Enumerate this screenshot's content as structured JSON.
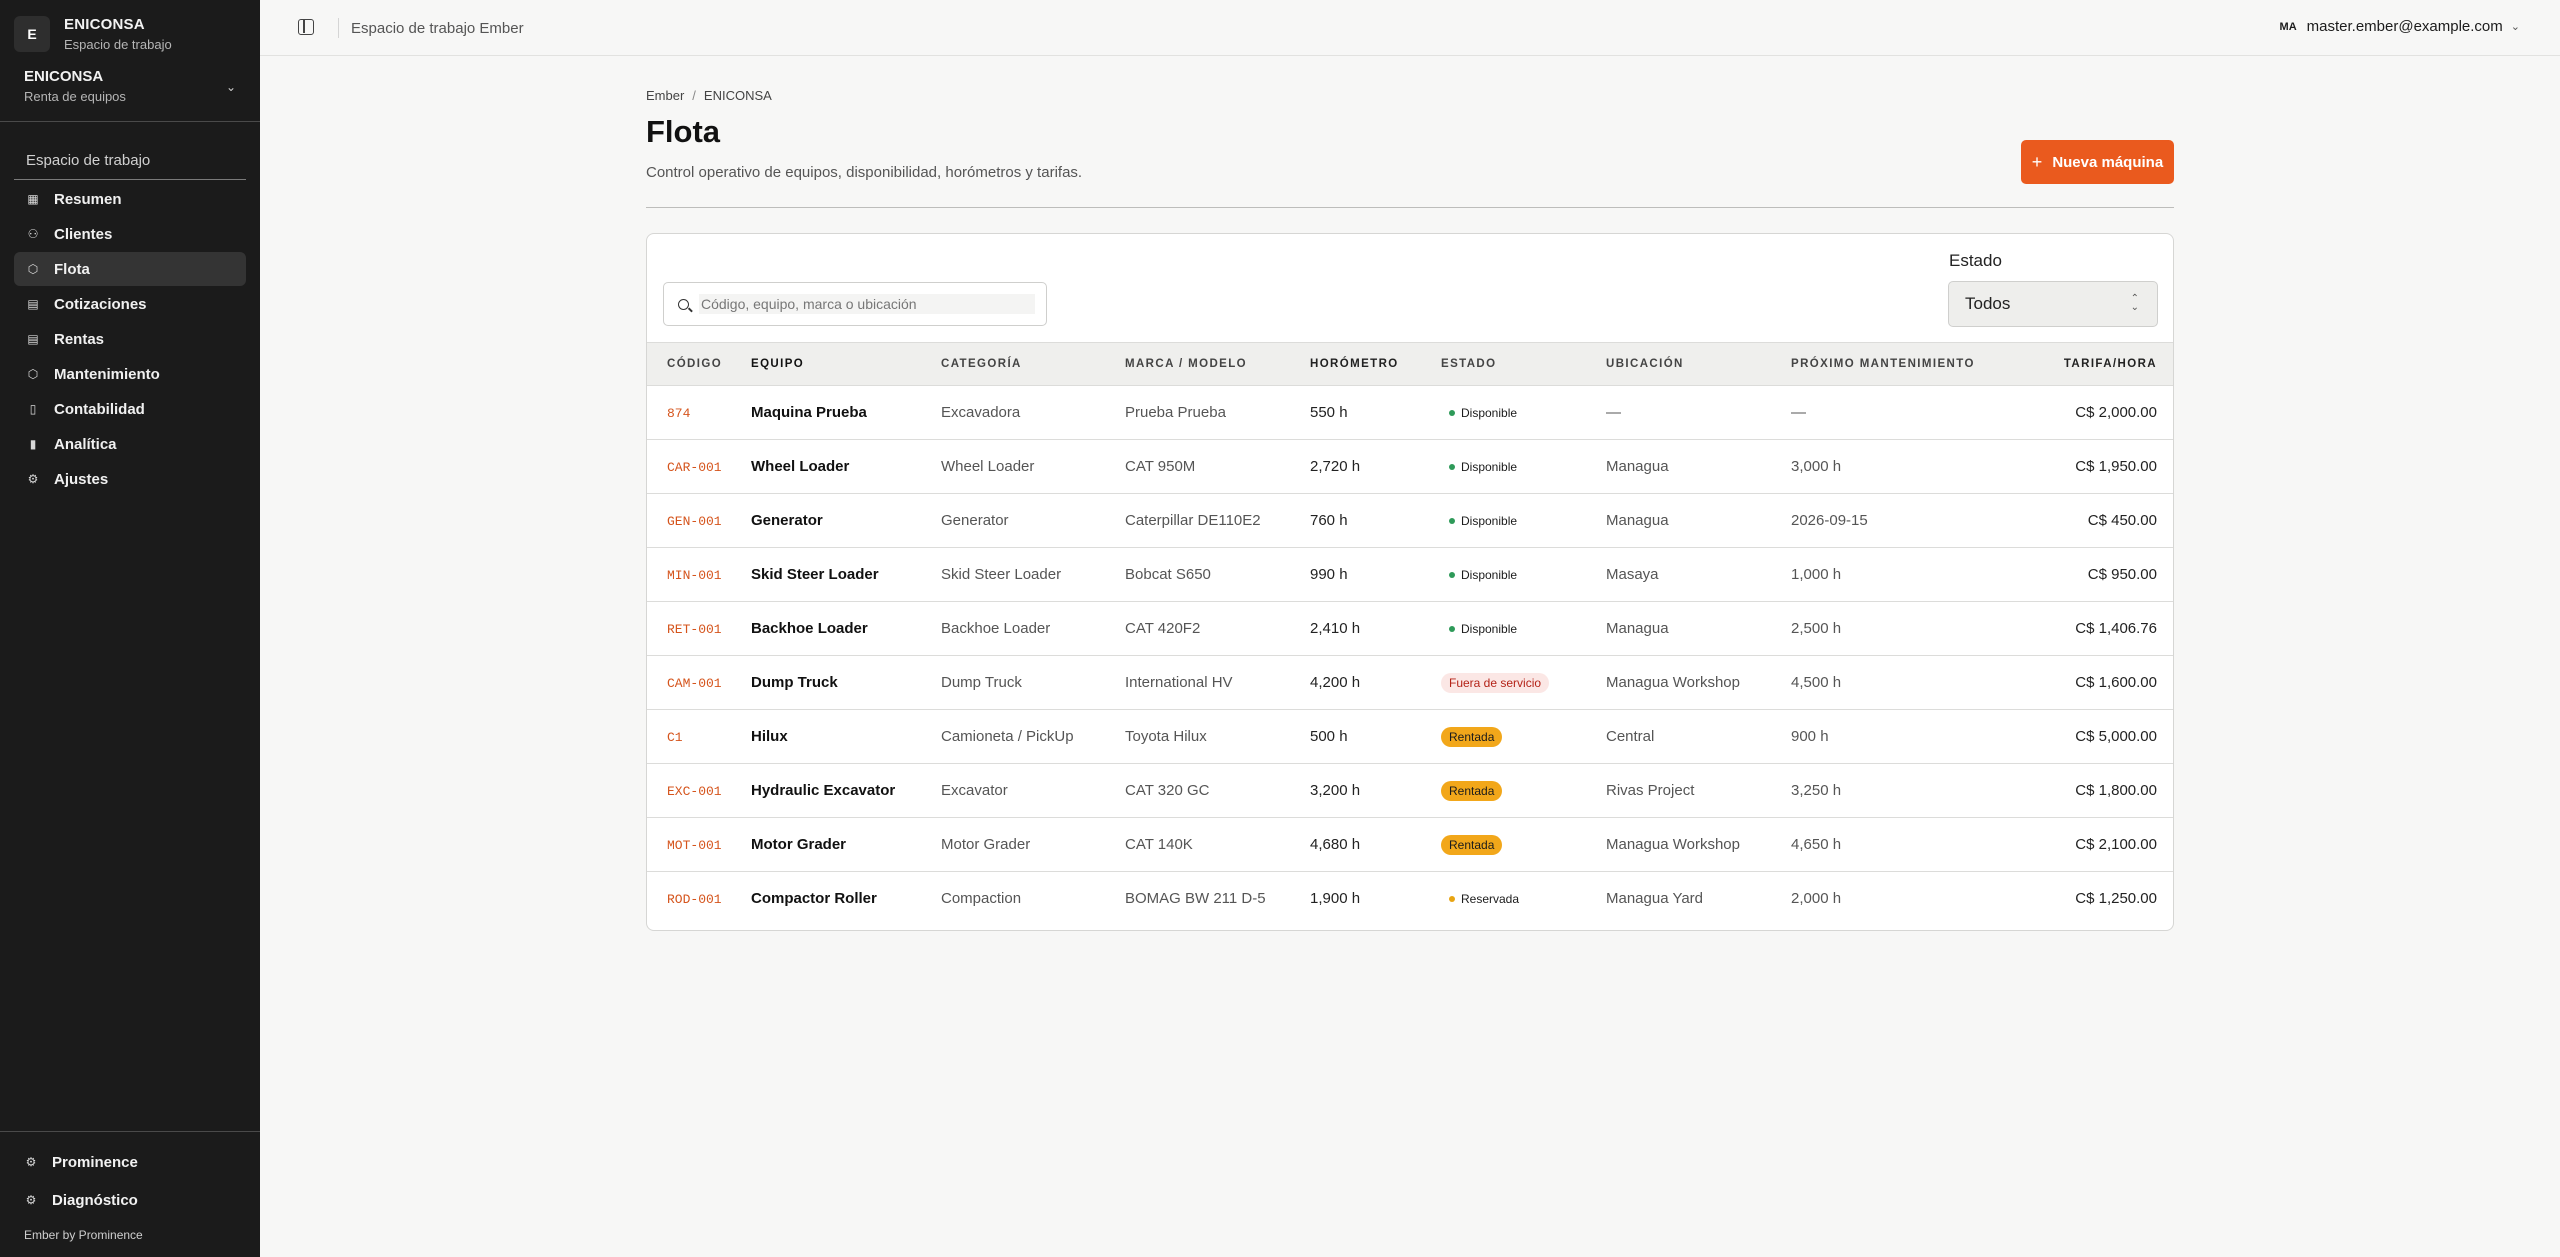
{
  "brand": {
    "initial": "E",
    "name": "ENICONSA",
    "subtitle": "Espacio de trabajo"
  },
  "org": {
    "name": "ENICONSA",
    "subtitle": "Renta de equipos"
  },
  "sidebar": {
    "section_label": "Espacio de trabajo",
    "items": [
      {
        "label": "Resumen",
        "icon": "grid-icon",
        "glyph": "▦"
      },
      {
        "label": "Clientes",
        "icon": "users-icon",
        "glyph": "⚇"
      },
      {
        "label": "Flota",
        "icon": "box-icon",
        "glyph": "⬡",
        "active": true
      },
      {
        "label": "Cotizaciones",
        "icon": "file-icon",
        "glyph": "▤"
      },
      {
        "label": "Rentas",
        "icon": "file-icon",
        "glyph": "▤"
      },
      {
        "label": "Mantenimiento",
        "icon": "box-icon",
        "glyph": "⬡"
      },
      {
        "label": "Contabilidad",
        "icon": "document-icon",
        "glyph": "▯"
      },
      {
        "label": "Analítica",
        "icon": "bar-chart-icon",
        "glyph": "▮"
      },
      {
        "label": "Ajustes",
        "icon": "gear-icon",
        "glyph": "⚙"
      }
    ],
    "footer": [
      {
        "label": "Prominence",
        "icon": "gear-icon",
        "glyph": "⚙"
      },
      {
        "label": "Diagnóstico",
        "icon": "gear-icon",
        "glyph": "⚙"
      }
    ],
    "credit": "Ember by Prominence"
  },
  "topbar": {
    "title": "Espacio de trabajo Ember",
    "user_initials": "MA",
    "user_email": "master.ember@example.com"
  },
  "breadcrumb": [
    "Ember",
    "ENICONSA"
  ],
  "page": {
    "title": "Flota",
    "description": "Control operativo de equipos, disponibilidad, horómetros y tarifas.",
    "new_button": "Nueva máquina"
  },
  "search": {
    "placeholder": "Código, equipo, marca o ubicación",
    "value": ""
  },
  "filter": {
    "label": "Estado",
    "value": "Todos"
  },
  "table": {
    "columns": [
      "CÓDIGO",
      "EQUIPO",
      "CATEGORÍA",
      "MARCA / MODELO",
      "HORÓMETRO",
      "ESTADO",
      "UBICACIÓN",
      "PRÓXIMO MANTENIMIENTO",
      "TARIFA/HORA"
    ],
    "rows": [
      {
        "code": "874",
        "equipo": "Maquina Prueba",
        "categoria": "Excavadora",
        "marca": "Prueba Prueba",
        "horometro": "550 h",
        "estado": "Disponible",
        "estado_kind": "disponible",
        "ubicacion": "—",
        "proximo": "—",
        "tarifa": "C$ 2,000.00"
      },
      {
        "code": "CAR-001",
        "equipo": "Wheel Loader",
        "categoria": "Wheel Loader",
        "marca": "CAT 950M",
        "horometro": "2,720 h",
        "estado": "Disponible",
        "estado_kind": "disponible",
        "ubicacion": "Managua",
        "proximo": "3,000 h",
        "tarifa": "C$ 1,950.00"
      },
      {
        "code": "GEN-001",
        "equipo": "Generator",
        "categoria": "Generator",
        "marca": "Caterpillar DE110E2",
        "horometro": "760 h",
        "estado": "Disponible",
        "estado_kind": "disponible",
        "ubicacion": "Managua",
        "proximo": "2026-09-15",
        "tarifa": "C$ 450.00"
      },
      {
        "code": "MIN-001",
        "equipo": "Skid Steer Loader",
        "categoria": "Skid Steer Loader",
        "marca": "Bobcat S650",
        "horometro": "990 h",
        "estado": "Disponible",
        "estado_kind": "disponible",
        "ubicacion": "Masaya",
        "proximo": "1,000 h",
        "tarifa": "C$ 950.00"
      },
      {
        "code": "RET-001",
        "equipo": "Backhoe Loader",
        "categoria": "Backhoe Loader",
        "marca": "CAT 420F2",
        "horometro": "2,410 h",
        "estado": "Disponible",
        "estado_kind": "disponible",
        "ubicacion": "Managua",
        "proximo": "2,500 h",
        "tarifa": "C$ 1,406.76"
      },
      {
        "code": "CAM-001",
        "equipo": "Dump Truck",
        "categoria": "Dump Truck",
        "marca": "International HV",
        "horometro": "4,200 h",
        "estado": "Fuera de servicio",
        "estado_kind": "fuera",
        "ubicacion": "Managua Workshop",
        "proximo": "4,500 h",
        "tarifa": "C$ 1,600.00"
      },
      {
        "code": "C1",
        "equipo": "Hilux",
        "categoria": "Camioneta / PickUp",
        "marca": "Toyota Hilux",
        "horometro": "500 h",
        "estado": "Rentada",
        "estado_kind": "rentada",
        "ubicacion": "Central",
        "proximo": "900 h",
        "tarifa": "C$ 5,000.00"
      },
      {
        "code": "EXC-001",
        "equipo": "Hydraulic Excavator",
        "categoria": "Excavator",
        "marca": "CAT 320 GC",
        "horometro": "3,200 h",
        "estado": "Rentada",
        "estado_kind": "rentada",
        "ubicacion": "Rivas Project",
        "proximo": "3,250 h",
        "tarifa": "C$ 1,800.00"
      },
      {
        "code": "MOT-001",
        "equipo": "Motor Grader",
        "categoria": "Motor Grader",
        "marca": "CAT 140K",
        "horometro": "4,680 h",
        "estado": "Rentada",
        "estado_kind": "rentada",
        "ubicacion": "Managua Workshop",
        "proximo": "4,650 h",
        "tarifa": "C$ 2,100.00"
      },
      {
        "code": "ROD-001",
        "equipo": "Compactor Roller",
        "categoria": "Compaction",
        "marca": "BOMAG BW 211 D-5",
        "horometro": "1,900 h",
        "estado": "Reservada",
        "estado_kind": "reservada",
        "ubicacion": "Managua Yard",
        "proximo": "2,000 h",
        "tarifa": "C$ 1,250.00"
      }
    ]
  },
  "colors": {
    "accent": "#ea5a1e",
    "code": "#d5541c",
    "sidebar_bg": "#1b1b1b",
    "available": "#2e9a59",
    "rented": "#f2a71a",
    "out_of_service": "#b42318",
    "reserved": "#e8a412"
  }
}
